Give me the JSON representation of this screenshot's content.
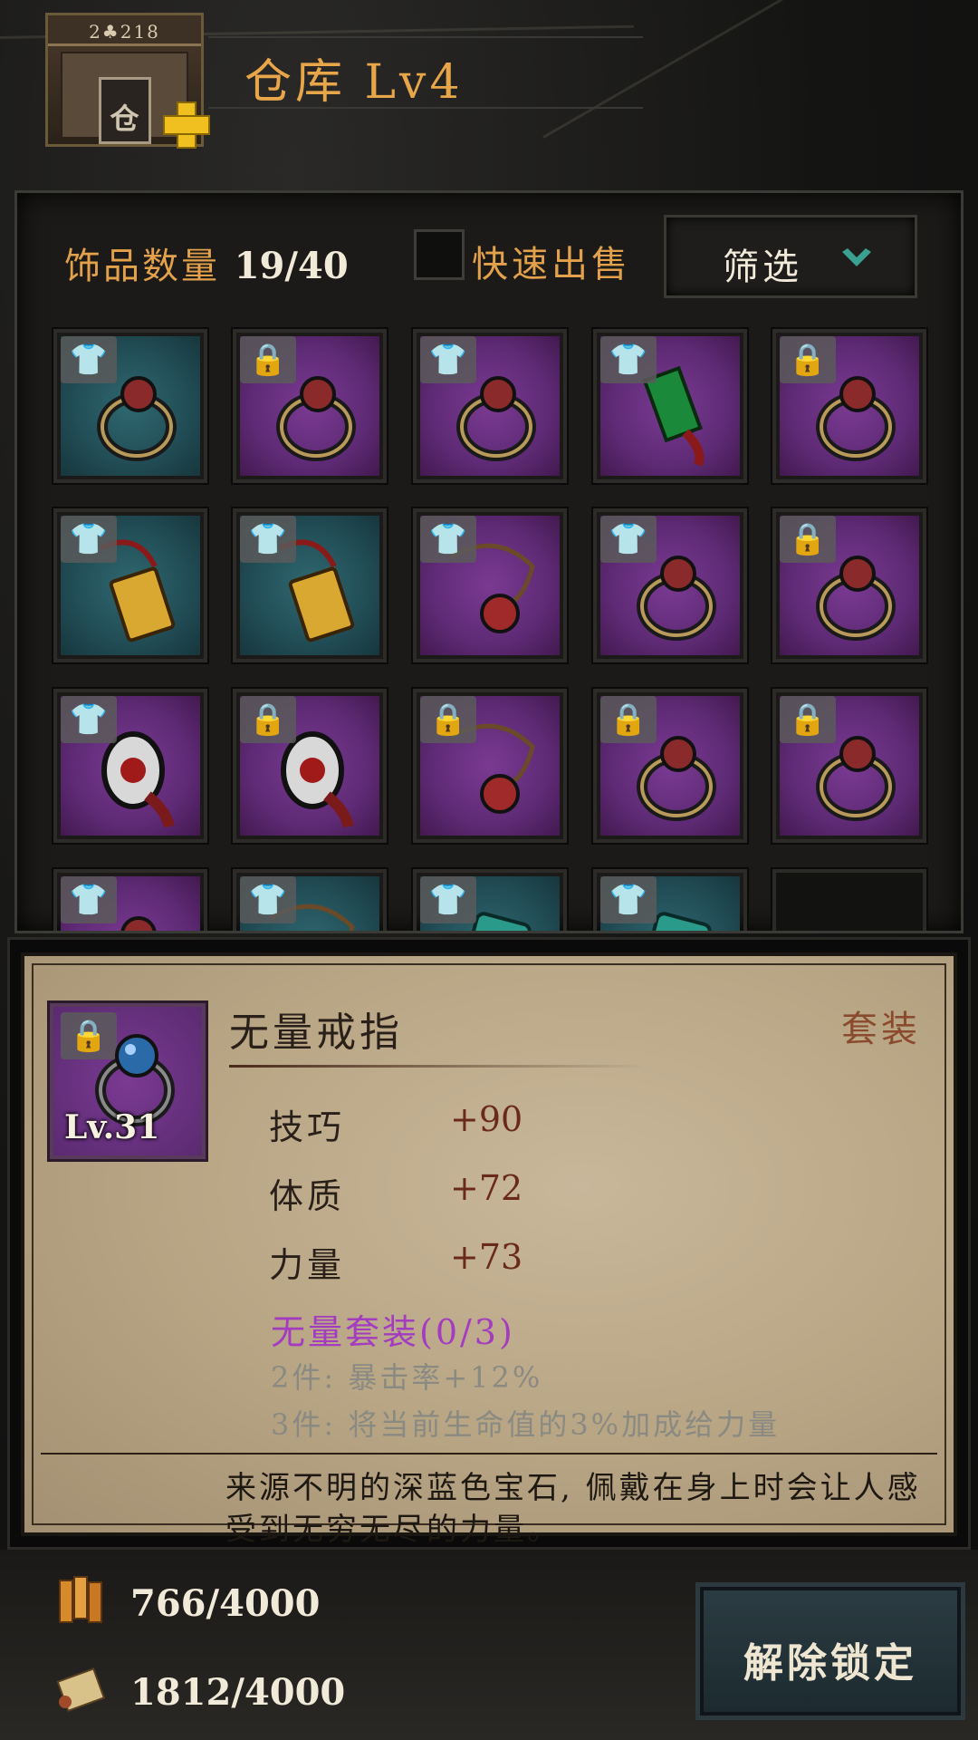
{
  "header": {
    "building_sign": "2♣218",
    "building_door_glyph": "仓",
    "title": "仓库  Lv4"
  },
  "storage": {
    "count_label": "饰品数量",
    "count_value": "19/40",
    "quick_sell_label": "快速出售",
    "filter_label": "筛选"
  },
  "slots": [
    {
      "rarity": "teal",
      "badge": "shirt-icon",
      "item": "ring-icon"
    },
    {
      "rarity": "purple",
      "badge": "lock-icon",
      "item": "ring-icon"
    },
    {
      "rarity": "purple",
      "badge": "shirt-icon",
      "item": "ring-icon"
    },
    {
      "rarity": "purple",
      "badge": "shirt-icon",
      "item": "gem-pendant-icon"
    },
    {
      "rarity": "purple",
      "badge": "lock-icon",
      "item": "ring-icon"
    },
    {
      "rarity": "teal",
      "badge": "shirt-icon",
      "item": "amulet-icon"
    },
    {
      "rarity": "teal",
      "badge": "shirt-icon",
      "item": "amulet-icon"
    },
    {
      "rarity": "purple",
      "badge": "shirt-icon",
      "item": "necklace-icon"
    },
    {
      "rarity": "purple",
      "badge": "shirt-icon",
      "item": "ring-icon"
    },
    {
      "rarity": "purple",
      "badge": "lock-icon",
      "item": "ring-icon"
    },
    {
      "rarity": "purple",
      "badge": "shirt-icon",
      "item": "charm-icon"
    },
    {
      "rarity": "purple",
      "badge": "lock-icon",
      "item": "charm-icon"
    },
    {
      "rarity": "purple",
      "badge": "lock-icon",
      "item": "necklace-icon"
    },
    {
      "rarity": "purple",
      "badge": "lock-icon",
      "item": "ring-icon"
    },
    {
      "rarity": "purple",
      "badge": "lock-icon",
      "item": "ring-icon"
    },
    {
      "rarity": "purple",
      "badge": "shirt-icon",
      "item": "ring-icon"
    },
    {
      "rarity": "teal",
      "badge": "shirt-icon",
      "item": "necklace-icon"
    },
    {
      "rarity": "teal",
      "badge": "shirt-icon",
      "item": "badge-icon"
    },
    {
      "rarity": "teal",
      "badge": "shirt-icon",
      "item": "badge-icon"
    },
    {
      "rarity": "empty",
      "badge": "",
      "item": ""
    }
  ],
  "detail": {
    "name": "无量戒指",
    "set_tag": "套装",
    "level": "Lv.31",
    "stats": [
      {
        "label": "技巧",
        "value": "+90"
      },
      {
        "label": "体质",
        "value": "+72"
      },
      {
        "label": "力量",
        "value": "+73"
      }
    ],
    "set_name": "无量套装(0/3)",
    "set_bonus_2": "2件: 暴击率+12%",
    "set_bonus_3": "3件: 将当前生命值的3%加成给力量",
    "description": "来源不明的深蓝色宝石, 佩戴在身上时会让人感受到无穷无尽的力量。"
  },
  "footer": {
    "resource_1": "766/4000",
    "resource_2": "1812/4000",
    "unlock_label": "解除锁定"
  },
  "colors": {
    "accent": "#e2a14a",
    "teal_slot": "#2f6870",
    "purple_slot": "#7a3a92",
    "set_text": "#a43cc0"
  }
}
